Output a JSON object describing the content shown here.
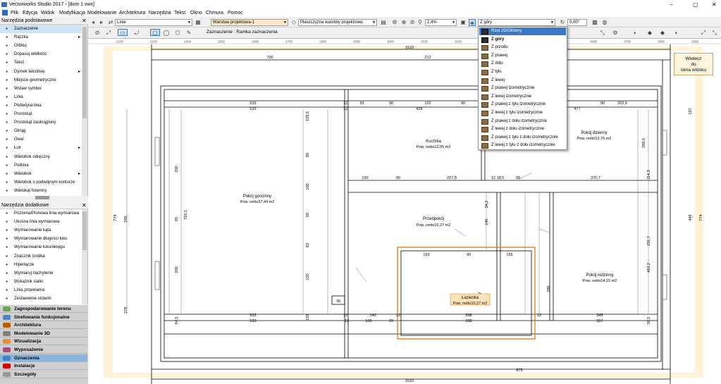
{
  "window": {
    "title": "Vectorworks Studio 2017 - [dom 1.vwx]",
    "controls": [
      "–",
      "▢",
      "✕"
    ]
  },
  "menu": [
    "Plik",
    "Edycja",
    "Widok",
    "Modyfikacja",
    "Modelowanie",
    "Architektura",
    "Narzędzia",
    "Tekst",
    "Okno",
    "Chmura",
    "Pomoc"
  ],
  "viewbar": {
    "class_value": "Linie",
    "layer_value": "Warstwa projektowa-1",
    "plane_value": "Płaszczyzna warstwy projektowej",
    "zoom_value": "2,4%",
    "view_value": "Z góry",
    "angle_value": "0,00°"
  },
  "mode_label": "Zaznaczenie : Ramka zaznaczenia",
  "palettes": {
    "basic": {
      "title": "Narzędzia podstawowe",
      "items": [
        {
          "label": "Zaznaczenie",
          "icon": "arrow-icon"
        },
        {
          "label": "Rączka",
          "icon": "hand-icon",
          "sub": true
        },
        {
          "label": "Orbituj",
          "icon": "orbit-icon"
        },
        {
          "label": "Dopasuj wielkość",
          "icon": "zoom-icon"
        },
        {
          "label": "Tekst",
          "icon": "text-icon"
        },
        {
          "label": "Dymek tekstowy",
          "icon": "callout-icon",
          "sub": true
        },
        {
          "label": "Miejsce geometryczne",
          "icon": "locus-icon"
        },
        {
          "label": "Wstaw symbol",
          "icon": "symbol-icon"
        },
        {
          "label": "Linia",
          "icon": "line-icon"
        },
        {
          "label": "Podwójna linia",
          "icon": "double-line-icon"
        },
        {
          "label": "Prostokąt",
          "icon": "rectangle-icon"
        },
        {
          "label": "Prostokąt zaokrąglony",
          "icon": "rounded-rectangle-icon"
        },
        {
          "label": "Okrąg",
          "icon": "circle-icon"
        },
        {
          "label": "Owal",
          "icon": "oval-icon"
        },
        {
          "label": "Łuk",
          "icon": "arc-icon",
          "sub": true
        },
        {
          "label": "Wielobok odręczny",
          "icon": "freehand-icon"
        },
        {
          "label": "Polilinia",
          "icon": "polyline-icon"
        },
        {
          "label": "Wielobok",
          "icon": "polygon-icon",
          "sub": true
        },
        {
          "label": "Wielobok o podwójnym konturze",
          "icon": "double-polygon-icon"
        },
        {
          "label": "Wielokąt foremny",
          "icon": "regular-polygon-icon"
        }
      ]
    },
    "extra": {
      "title": "Narzędzia dodatkowe",
      "items": [
        {
          "label": "Pozioma/Pionowa linia wymiarowa",
          "icon": "dimension-icon"
        },
        {
          "label": "Ukośna linia wymiarowa",
          "icon": "oblique-dimension-icon"
        },
        {
          "label": "Wymiarowanie kąta",
          "icon": "angle-icon"
        },
        {
          "label": "Wymiarowanie długości łuku",
          "icon": "arc-length-icon"
        },
        {
          "label": "Wymiarowanie łuku/okręgu",
          "icon": "radial-icon"
        },
        {
          "label": "Znacznik środka",
          "icon": "center-mark-icon"
        },
        {
          "label": "Hiperłącze",
          "icon": "link-icon"
        },
        {
          "label": "Wymiaruj nachylenie",
          "icon": "slope-icon"
        },
        {
          "label": "Wskaźnik siatki",
          "icon": "grid-bubble-icon"
        },
        {
          "label": "Linia przewiania",
          "icon": "section-line-icon"
        },
        {
          "label": "Zestawienie stolarki",
          "icon": "schedule-icon"
        }
      ]
    },
    "sets": [
      {
        "label": "Zagospodarowanie terenu",
        "color": "#6aa84f"
      },
      {
        "label": "Strefowanie funkcjonalne",
        "color": "#4a86c8"
      },
      {
        "label": "Architektura",
        "color": "#b45f06"
      },
      {
        "label": "Modelowanie 3D",
        "color": "#7f7f7f"
      },
      {
        "label": "Wizualizacja",
        "color": "#e69138"
      },
      {
        "label": "Wyposażenie",
        "color": "#a64d79"
      },
      {
        "label": "Oznaczenia",
        "color": "#3d85c6"
      },
      {
        "label": "Instalacje",
        "color": "#cc0000"
      },
      {
        "label": "Szczegóły",
        "color": "#999999"
      }
    ]
  },
  "view_dropdown": {
    "items": [
      "Rzut 2D/Główny",
      "Z góry",
      "Z przodu",
      "Z prawej",
      "Z dołu",
      "Z tyłu",
      "Z lewej",
      "Z prawej izometrycznie",
      "Z lewej izometrycznie",
      "Z prawej z tyłu izometrycznie",
      "Z lewej z tyłu izometrycznie",
      "Z prawej z dołu izometrycznie",
      "Z lewej z dołu izometrycznie",
      "Z prawej z tyłu z dołu izometrycznie",
      "Z lewej z tyłu z dołu izometrycznie"
    ],
    "highlighted": 0,
    "bold": 1
  },
  "fit_button": {
    "line1": "Wielecz",
    "line2": "do",
    "line3": "okna widoku"
  },
  "ruler_ticks": [
    "2100",
    "2200",
    "2400",
    "2500",
    "2600",
    "2700",
    "2800",
    "2900",
    "3000",
    "3100",
    "3200",
    "3300",
    "3400",
    "3500",
    "3600",
    "3700",
    "3800",
    "3900",
    "4000"
  ],
  "rooms": [
    {
      "name": "Pokój gościnny",
      "area": "Pow. netto37,44 m2"
    },
    {
      "name": "Kuchnia",
      "area": "Pow. netto12,05 m2"
    },
    {
      "name": "Przedpokój",
      "area": "Pow. netto10,27 m2"
    },
    {
      "name": "Łazienka",
      "area": "Pow. netto10,27 m2"
    },
    {
      "name": "Pokój dzienny",
      "area": "Pow. netto13,76 m2"
    },
    {
      "name": "Pokój rodzinny",
      "area": "Pow. netto14,15 m2"
    }
  ],
  "dims": {
    "d1510": "1510",
    "d700": "700",
    "d212": "212",
    "d875": "875",
    "d533": "533",
    "d418": "418",
    "d477": "477",
    "d202": "202,5",
    "d12": "12",
    "d81": "81",
    "d90": "90",
    "d122": "122",
    "d100": "100",
    "d227": "227,8",
    "d18": "18,5",
    "d370": "370,7",
    "d153": "153",
    "d155": "155",
    "d140": "140",
    "d29": "29",
    "d398": "398",
    "d345": "345",
    "d357": "357",
    "d36": "36",
    "d774": "774",
    "d295": "295",
    "d710": "710,5",
    "d95": "95",
    "d200": "200",
    "d279": "279",
    "d64": "64,5",
    "d128": "128,5",
    "d63": "63",
    "d120": "120",
    "d159": "159",
    "d157": "157",
    "d448": "448",
    "d288": "288,5",
    "d114": "114,3",
    "d231": "231,7",
    "d410": "410,2",
    "d286": "286",
    "d34": "34,2",
    "d58": "58,5",
    "d137": "53,7"
  }
}
